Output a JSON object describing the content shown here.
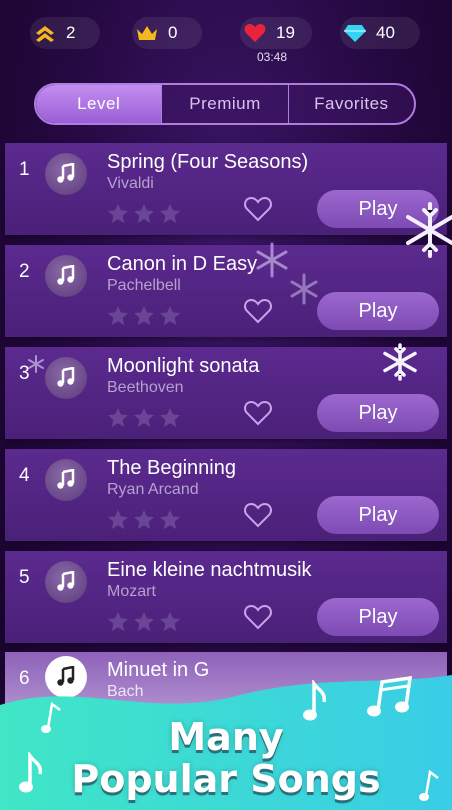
{
  "stats": [
    {
      "icon": "chevrons-up-icon",
      "value": "2"
    },
    {
      "icon": "crown-icon",
      "value": "0"
    },
    {
      "icon": "heart-icon",
      "value": "19"
    },
    {
      "icon": "diamond-icon",
      "value": "40"
    }
  ],
  "timer": "03:48",
  "tabs": [
    {
      "label": "Level",
      "active": true
    },
    {
      "label": "Premium",
      "active": false
    },
    {
      "label": "Favorites",
      "active": false
    }
  ],
  "songs": [
    {
      "num": "1",
      "title": "Spring (Four Seasons)",
      "artist": "Vivaldi",
      "play": "Play"
    },
    {
      "num": "2",
      "title": "Canon in D Easy",
      "artist": "Pachelbell",
      "play": "Play"
    },
    {
      "num": "3",
      "title": "Moonlight sonata",
      "artist": "Beethoven",
      "play": "Play"
    },
    {
      "num": "4",
      "title": "The Beginning",
      "artist": "Ryan Arcand",
      "play": "Play"
    },
    {
      "num": "5",
      "title": "Eine kleine nachtmusik",
      "artist": "Mozart",
      "play": "Play"
    },
    {
      "num": "6",
      "title": "Minuet in G",
      "artist": "Bach",
      "play": ""
    }
  ],
  "banner": {
    "line1": "Many",
    "line2": "Popular Songs"
  },
  "colors": {
    "accent": "#9c68cf",
    "banner_teal": "#3ee0c8",
    "heart": "#e8243c",
    "diamond": "#33d6f0",
    "crown": "#f2b81e"
  }
}
